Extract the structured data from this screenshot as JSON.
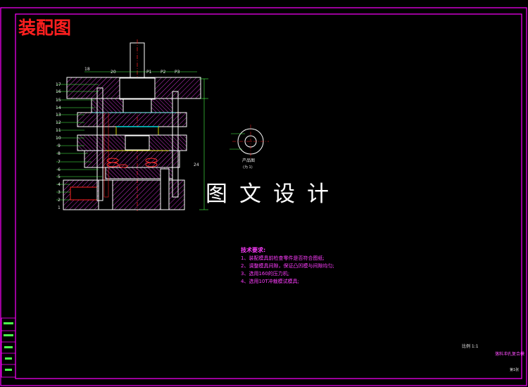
{
  "drawing_title": "装配图",
  "watermark": "图文设计",
  "technical_requirements": {
    "heading": "技术要求:",
    "items": [
      "1、装配模具前检查零件是否符合图纸;",
      "2、调整模具间隙，保证凸凹模与间隙均匀;",
      "3、选用160的压力机;",
      "4、选用10T冲裁模试模具;"
    ]
  },
  "product_view": {
    "label": "产品图",
    "sublabel": "(为 1)"
  },
  "title_block": {
    "scale": "比例 1:1",
    "sheet": "第1张",
    "name": "落料冲孔复合模"
  },
  "colors": {
    "background": "#000000",
    "frame": "#ff00ff",
    "outline": "#ffffff",
    "centerline": "#ff2020",
    "hatch": "#ff40ff",
    "dimension": "#4cff4c",
    "cyan": "#00ffff",
    "yellow": "#ffff00"
  }
}
